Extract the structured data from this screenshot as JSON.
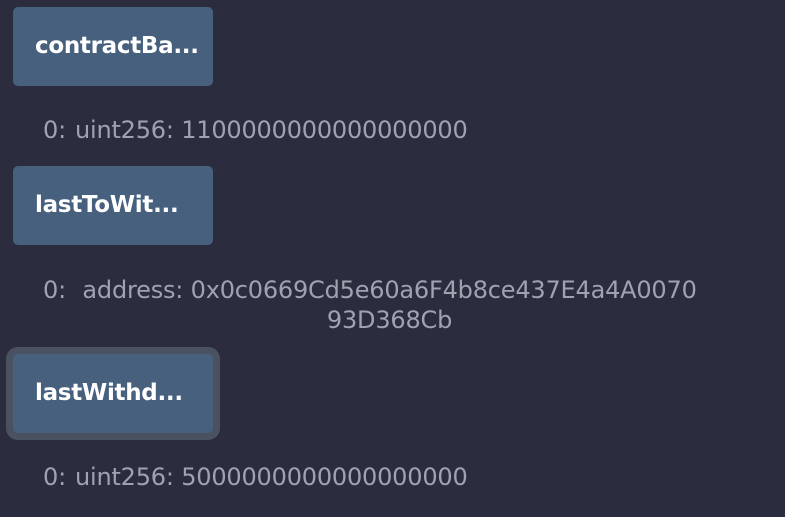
{
  "functions": [
    {
      "label": "contractBa...",
      "output_index": "0:",
      "output_type": "uint256:",
      "output_value": "1100000000000000000"
    },
    {
      "label": "lastToWit...",
      "output_index": "0:",
      "output_type": "address:",
      "output_value_line1": "0x0c0669Cd5e60a6F4b8ce437E4a4A0070",
      "output_value_line2": "93D368Cb"
    },
    {
      "label": "lastWithd...",
      "output_index": "0:",
      "output_type": "uint256:",
      "output_value": "5000000000000000000"
    }
  ],
  "colors": {
    "background": "#2b2c3d",
    "button": "#46607e",
    "button_text": "#ffffff",
    "result_text": "#9fa3b0",
    "focus_ring": "#4a5262"
  }
}
